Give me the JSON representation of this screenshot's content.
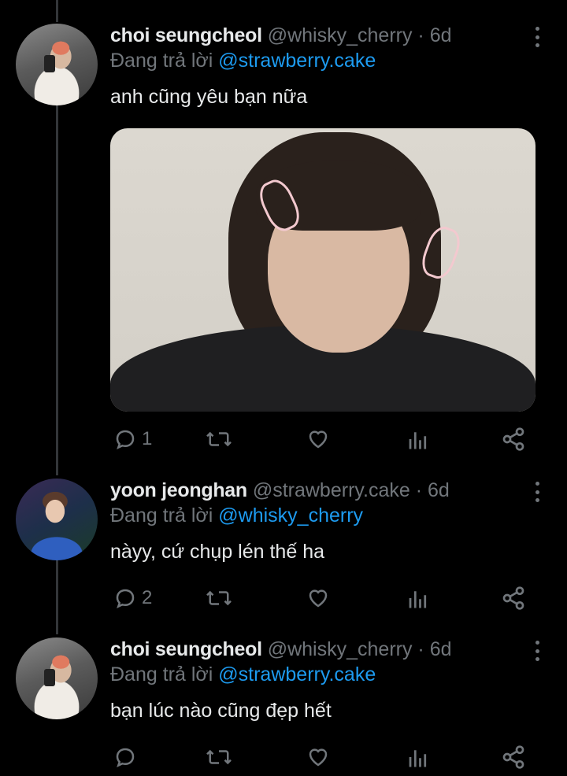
{
  "tweets": [
    {
      "name": "choi seungcheol",
      "handle": "@whisky_cherry · 6d",
      "reply_prefix": "Đang trả lời ",
      "reply_mention": "@strawberry.cake",
      "text": "anh cũng yêu bạn nữa",
      "reply_count": "1",
      "has_media": true
    },
    {
      "name": "yoon jeonghan",
      "handle": "@strawberry.cake · 6d",
      "reply_prefix": "Đang trả lời ",
      "reply_mention": "@whisky_cherry",
      "text": "nàyy, cứ chụp lén thế ha",
      "reply_count": "2",
      "has_media": false
    },
    {
      "name": "choi seungcheol",
      "handle": "@whisky_cherry · 6d",
      "reply_prefix": "Đang trả lời ",
      "reply_mention": "@strawberry.cake",
      "text": "bạn lúc nào cũng đẹp hết",
      "reply_count": "",
      "has_media": false
    }
  ],
  "icons": {
    "reply": "reply-icon",
    "retweet": "retweet-icon",
    "like": "heart-icon",
    "views": "analytics-icon",
    "share": "share-icon",
    "more": "more-vertical-icon"
  },
  "colors": {
    "background": "#000000",
    "text": "#e7e9ea",
    "muted": "#71767b",
    "mention": "#1d9bf0",
    "thread_line": "#333639"
  }
}
